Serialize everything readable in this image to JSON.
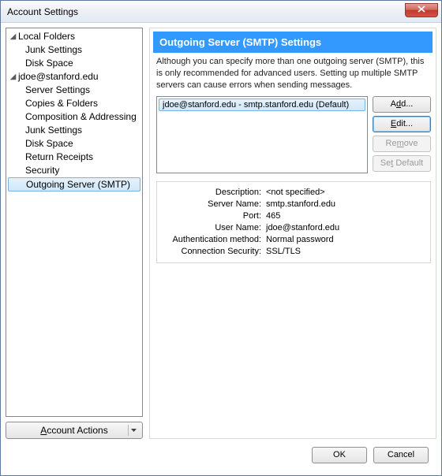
{
  "window": {
    "title": "Account Settings"
  },
  "tree": {
    "local_folders": "Local Folders",
    "local_children": {
      "junk": "Junk Settings",
      "disk": "Disk Space"
    },
    "account": "jdoe@stanford.edu",
    "account_children": {
      "server": "Server Settings",
      "copies": "Copies & Folders",
      "compose": "Composition & Addressing",
      "junk": "Junk Settings",
      "disk": "Disk Space",
      "receipts": "Return Receipts",
      "security": "Security"
    },
    "outgoing": "Outgoing Server (SMTP)"
  },
  "account_actions_label": "Account Actions",
  "panel": {
    "heading": "Outgoing Server (SMTP) Settings",
    "description": "Although you can specify more than one outgoing server (SMTP), this is only recommended for advanced users. Setting up multiple SMTP servers can cause errors when sending messages.",
    "server_entry": "jdoe@stanford.edu - smtp.stanford.edu (Default)",
    "buttons": {
      "add": "Add...",
      "edit": "Edit...",
      "remove": "Remove",
      "set_default": "Set Default"
    },
    "details": {
      "labels": {
        "description": "Description:",
        "server_name": "Server Name:",
        "port": "Port:",
        "user_name": "User Name:",
        "auth": "Authentication method:",
        "security": "Connection Security:"
      },
      "values": {
        "description": "<not specified>",
        "server_name": "smtp.stanford.edu",
        "port": "465",
        "user_name": "jdoe@stanford.edu",
        "auth": "Normal password",
        "security": "SSL/TLS"
      }
    }
  },
  "footer": {
    "ok": "OK",
    "cancel": "Cancel"
  }
}
